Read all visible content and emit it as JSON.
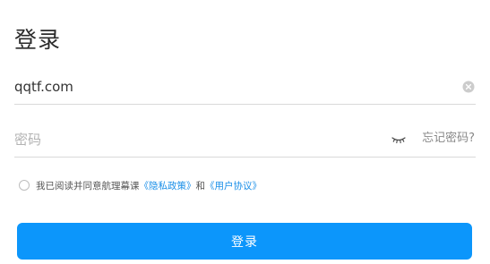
{
  "page": {
    "title": "登录"
  },
  "account": {
    "value": "qqtf.com",
    "clear_icon": "clear-circle-icon"
  },
  "password": {
    "value": "",
    "placeholder": "密码",
    "toggle_icon": "eye-closed-icon",
    "forgot_label": "忘记密码?"
  },
  "agreement": {
    "checked": false,
    "prefix": "我已阅读并同意航理幕课",
    "privacy_link": "《隐私政策》",
    "conjunction": "和",
    "user_link": "《用户协议》"
  },
  "login_button": {
    "label": "登录"
  },
  "colors": {
    "accent": "#0c96fb",
    "link": "#1a8fe8",
    "divider": "#d9d9d9"
  }
}
